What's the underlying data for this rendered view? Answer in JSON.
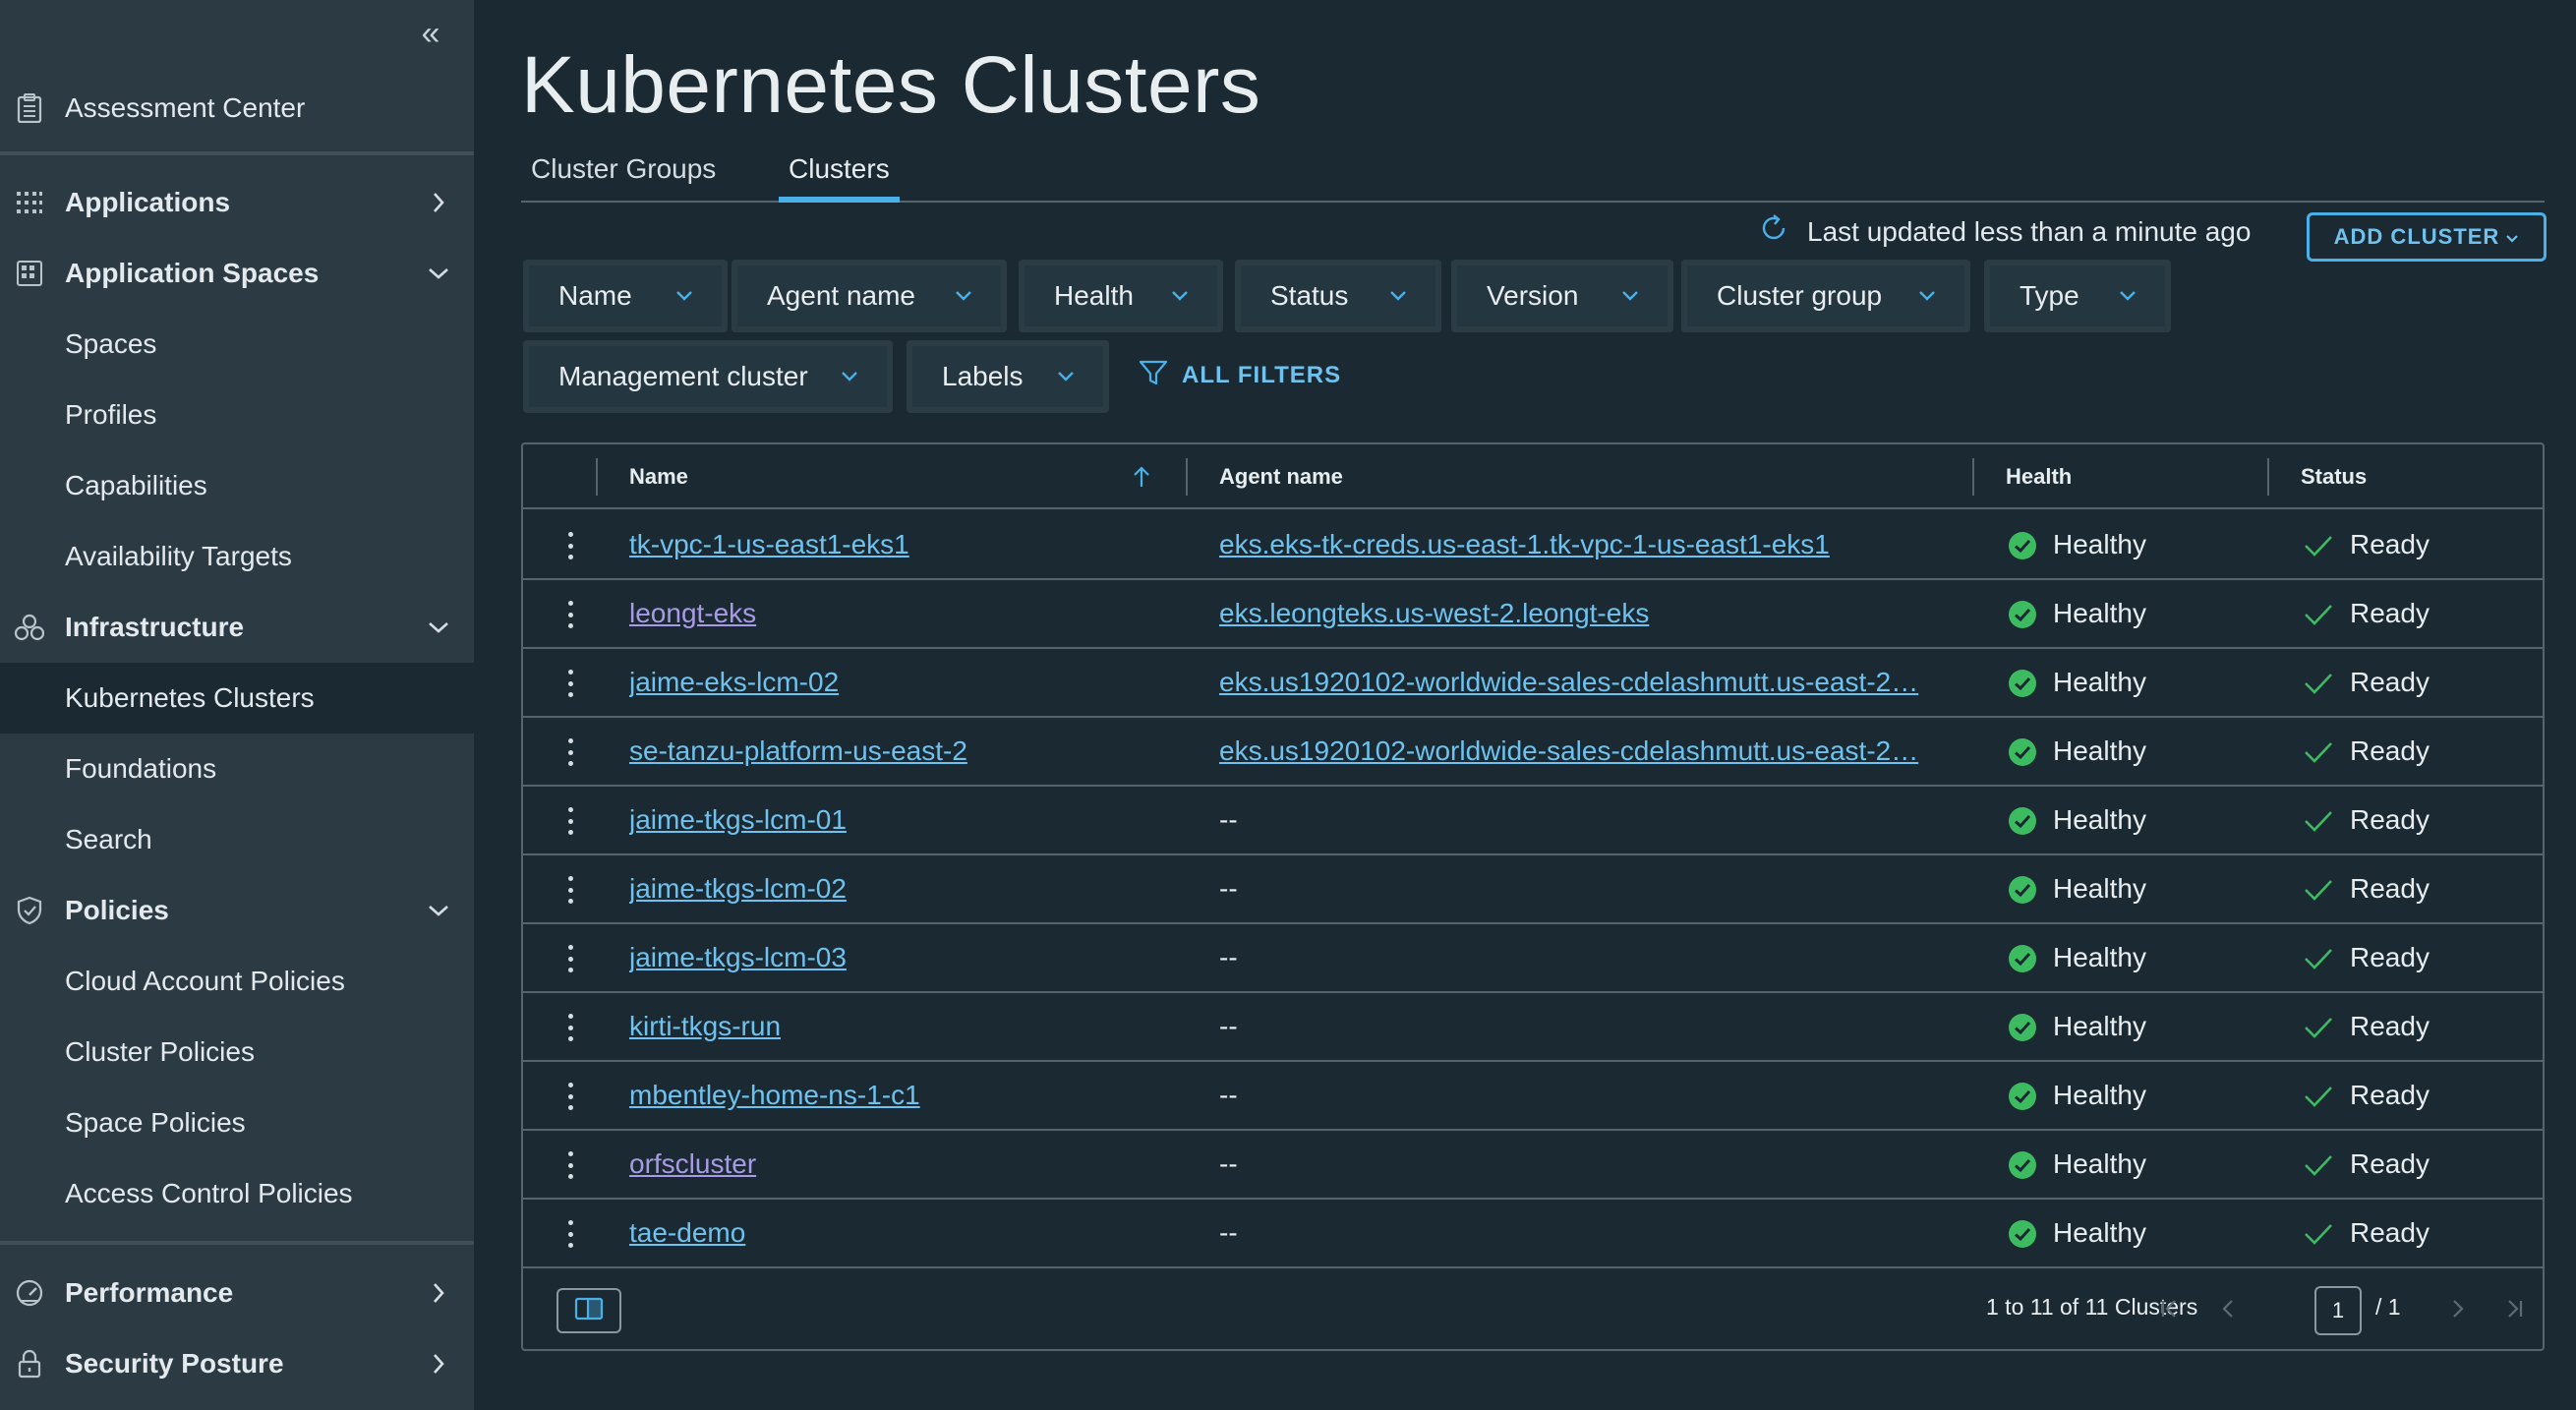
{
  "sidebar": {
    "items": [
      {
        "label": "Assessment Center"
      },
      {
        "label": "Applications"
      },
      {
        "label": "Application Spaces"
      },
      {
        "label": "Spaces"
      },
      {
        "label": "Profiles"
      },
      {
        "label": "Capabilities"
      },
      {
        "label": "Availability Targets"
      },
      {
        "label": "Infrastructure"
      },
      {
        "label": "Kubernetes Clusters"
      },
      {
        "label": "Foundations"
      },
      {
        "label": "Search"
      },
      {
        "label": "Policies"
      },
      {
        "label": "Cloud Account Policies"
      },
      {
        "label": "Cluster Policies"
      },
      {
        "label": "Space Policies"
      },
      {
        "label": "Access Control Policies"
      },
      {
        "label": "Performance"
      },
      {
        "label": "Security Posture"
      }
    ]
  },
  "page": {
    "title": "Kubernetes Clusters",
    "tabs": [
      {
        "label": "Cluster Groups"
      },
      {
        "label": "Clusters"
      }
    ],
    "active_tab": "Clusters",
    "last_updated": "Last updated less than a minute ago",
    "add_cluster": "ADD CLUSTER"
  },
  "filters": [
    {
      "label": "Name"
    },
    {
      "label": "Agent name"
    },
    {
      "label": "Health"
    },
    {
      "label": "Status"
    },
    {
      "label": "Version"
    },
    {
      "label": "Cluster group"
    },
    {
      "label": "Type"
    },
    {
      "label": "Management cluster"
    },
    {
      "label": "Labels"
    }
  ],
  "all_filters": "ALL FILTERS",
  "table": {
    "columns": [
      "Name",
      "Agent name",
      "Health",
      "Status"
    ],
    "rows": [
      {
        "name": "tk-vpc-1-us-east1-eks1",
        "agent": "eks.eks-tk-creds.us-east-1.tk-vpc-1-us-east1-eks1",
        "health": "Healthy",
        "status": "Ready"
      },
      {
        "name": "leongt-eks",
        "agent": "eks.leongteks.us-west-2.leongt-eks",
        "health": "Healthy",
        "status": "Ready"
      },
      {
        "name": "jaime-eks-lcm-02",
        "agent": "eks.us1920102-worldwide-sales-cdelashmutt.us-east-2…",
        "health": "Healthy",
        "status": "Ready"
      },
      {
        "name": "se-tanzu-platform-us-east-2",
        "agent": "eks.us1920102-worldwide-sales-cdelashmutt.us-east-2…",
        "health": "Healthy",
        "status": "Ready"
      },
      {
        "name": "jaime-tkgs-lcm-01",
        "agent": "--",
        "health": "Healthy",
        "status": "Ready"
      },
      {
        "name": "jaime-tkgs-lcm-02",
        "agent": "--",
        "health": "Healthy",
        "status": "Ready"
      },
      {
        "name": "jaime-tkgs-lcm-03",
        "agent": "--",
        "health": "Healthy",
        "status": "Ready"
      },
      {
        "name": "kirti-tkgs-run",
        "agent": "--",
        "health": "Healthy",
        "status": "Ready"
      },
      {
        "name": "mbentley-home-ns-1-c1",
        "agent": "--",
        "health": "Healthy",
        "status": "Ready"
      },
      {
        "name": "orfscluster",
        "agent": "--",
        "health": "Healthy",
        "status": "Ready"
      },
      {
        "name": "tae-demo",
        "agent": "--",
        "health": "Healthy",
        "status": "Ready"
      }
    ],
    "pager": {
      "summary": "1 to 11 of 11 Clusters",
      "current": "1",
      "total": "/ 1"
    }
  },
  "colors": {
    "accent": "#4ab0e8",
    "healthy": "#3dbb61",
    "ready": "#3dbb61",
    "visited": "#a99ae6"
  },
  "icons": {
    "assessment": "clipboard-icon",
    "applications": "grid-icon",
    "application_spaces": "spaces-icon",
    "infrastructure": "nodes-icon",
    "policies": "shield-icon",
    "performance": "gauge-icon",
    "security_posture": "lock-icon"
  }
}
